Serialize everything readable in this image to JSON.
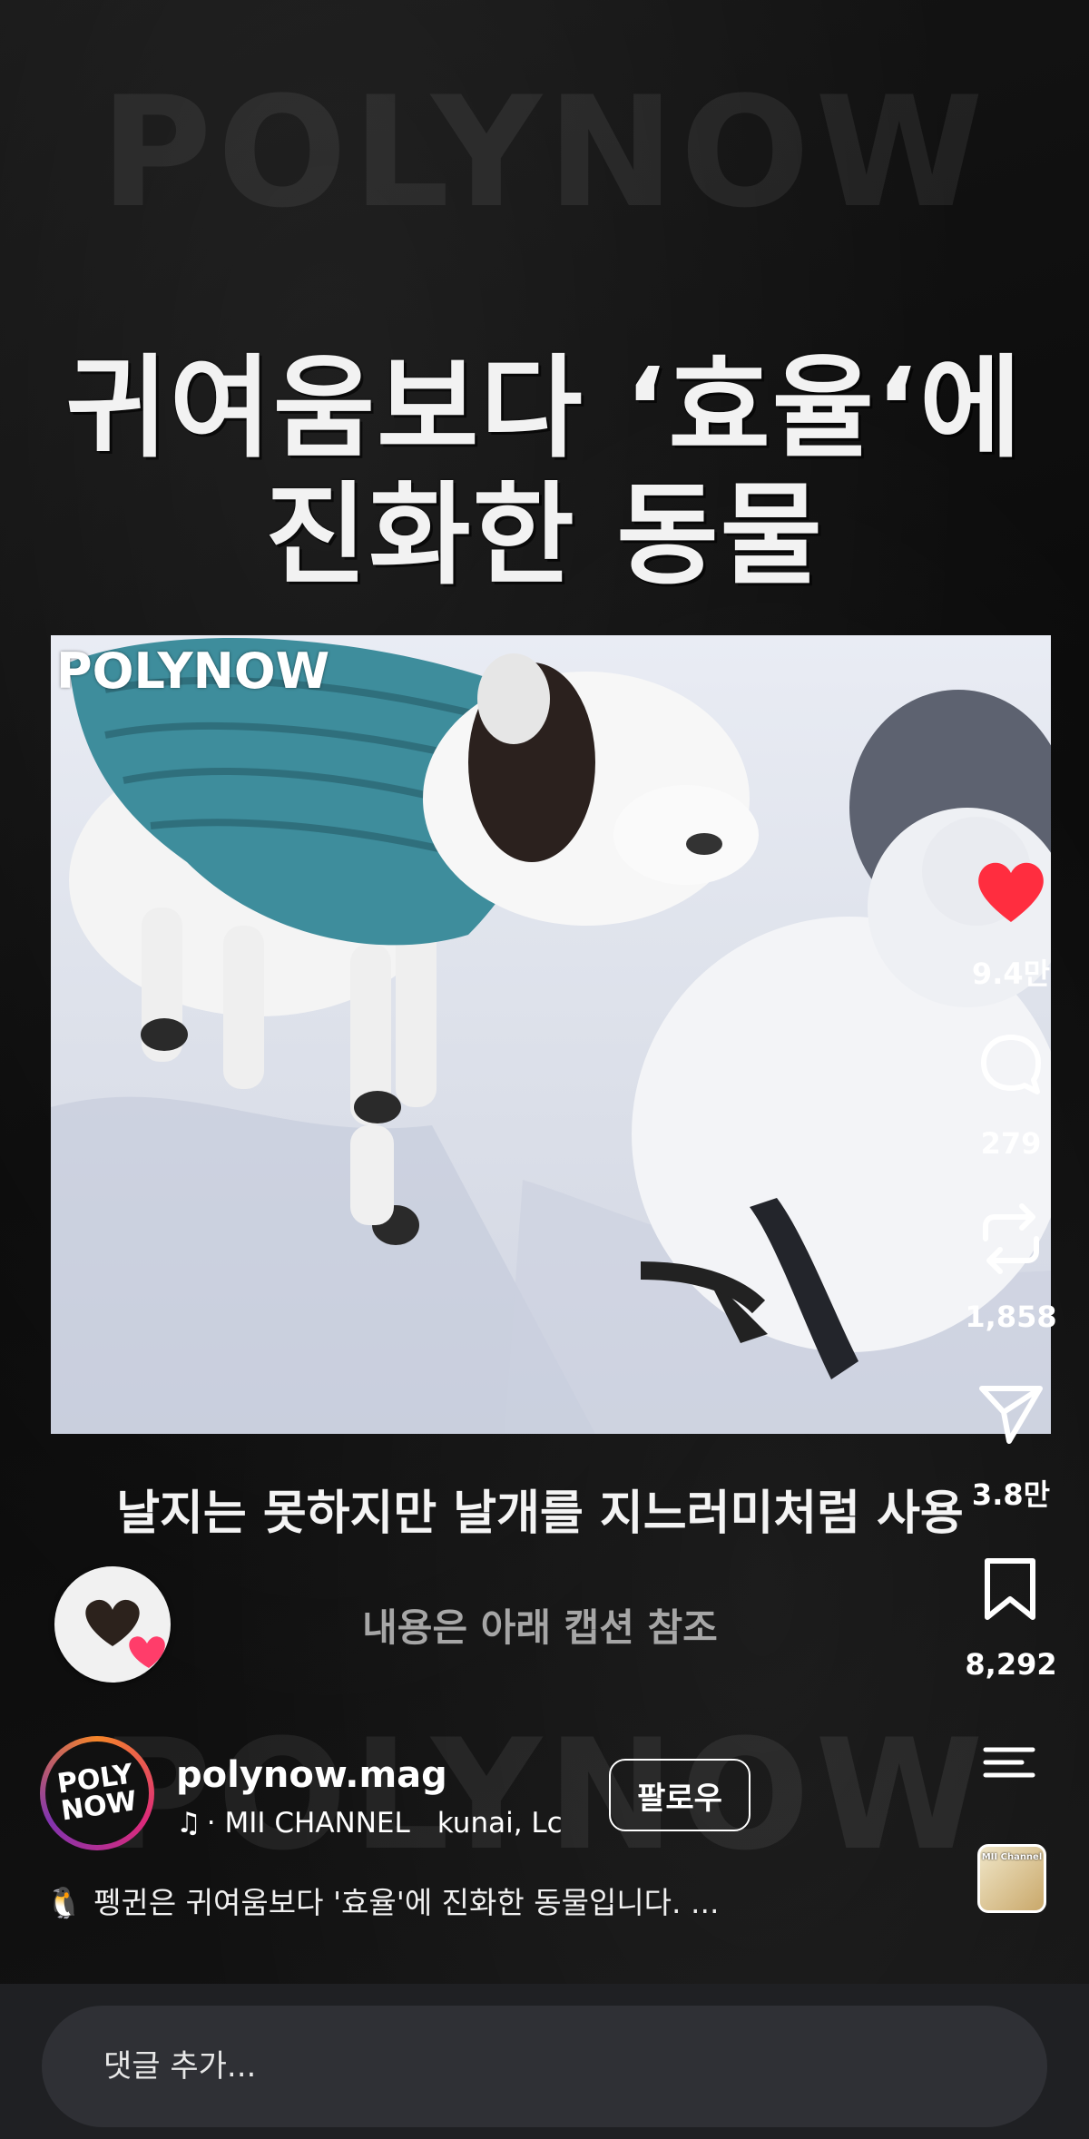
{
  "post": {
    "watermark": "POLYNOW",
    "headline_line1": "귀여움보다 ‘효율‘에",
    "headline_line2": "진화한 동물",
    "video_logo": "POLYNOW",
    "caption": "날지는 못하지만 날개를 지느러미처럼 사용",
    "subcaption": "내용은 아래 캡션 참조"
  },
  "actions": {
    "like_count": "9.4만",
    "comment_count": "279",
    "repost_count": "1,858",
    "share_count": "3.8만",
    "save_count": "8,292",
    "like_color": "#ff2d3f"
  },
  "profile": {
    "avatar_text": "POLY NOW",
    "username": "polynow.mag",
    "music_artist": "· MII CHANNEL",
    "music_track": "kunai, Lc",
    "follow_label": "팔로우"
  },
  "description": {
    "emoji": "🐧",
    "text": "펭귄은 귀여움보다 '효율'에 진화한 동물입니다. ..."
  },
  "album": {
    "label": "MII Channel"
  },
  "comment": {
    "placeholder": "댓글 추가..."
  }
}
